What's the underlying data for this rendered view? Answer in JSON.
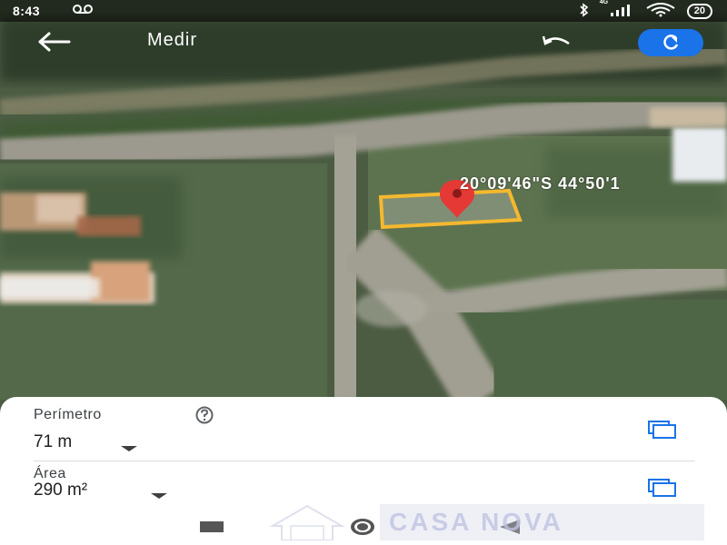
{
  "status_bar": {
    "time": "8:43",
    "network_label": "4G",
    "battery": "20"
  },
  "app_bar": {
    "title": "Medir",
    "icons": {
      "back": "arrow-left-icon",
      "undo": "undo-icon",
      "reset": "refresh-icon"
    }
  },
  "map": {
    "coordinates": "20°09'46\"S 44°50'1",
    "pin": "location-pin-icon",
    "polygon_color": "#f5b82e",
    "pin_color": "#e53935"
  },
  "measurements": {
    "perimeter_label": "Perímetro",
    "perimeter_value": "71 m",
    "area_label": "Área",
    "area_value": "290 m²"
  },
  "watermark": {
    "text": "CASA NOVA"
  },
  "colors": {
    "accent": "#1a73e8",
    "sheet_bg": "#ffffff"
  }
}
